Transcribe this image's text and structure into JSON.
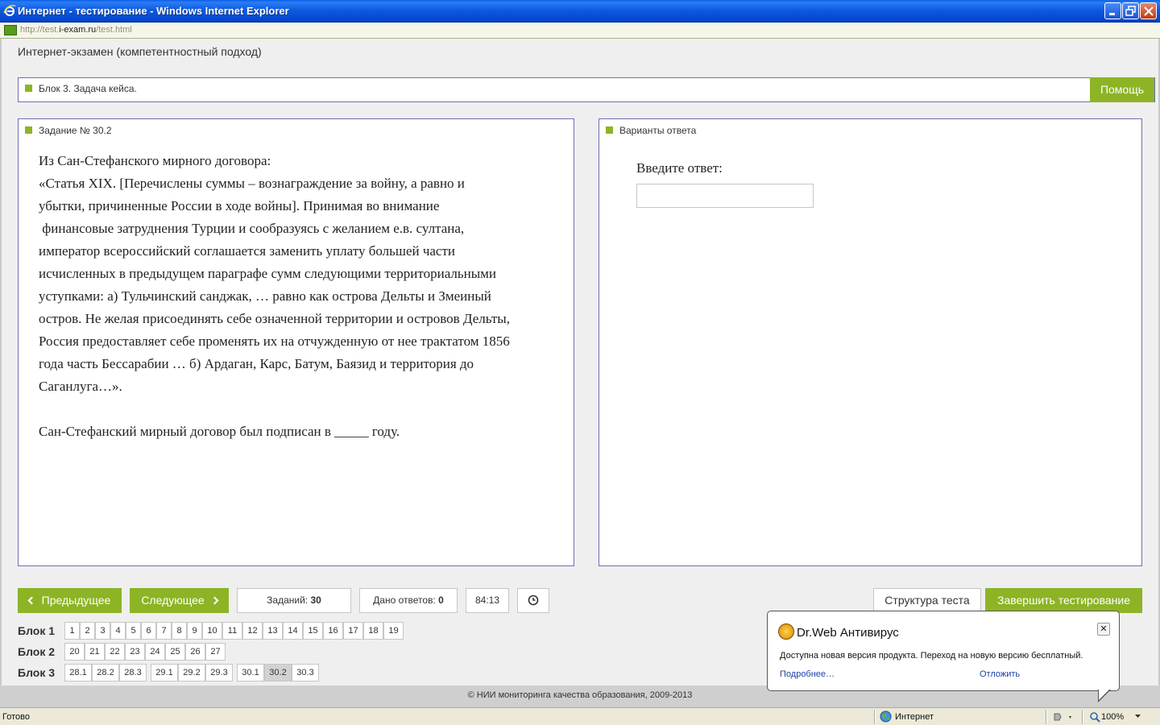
{
  "window": {
    "title": "Интернет - тестирование - Windows Internet Explorer",
    "url_prefix": "http://test.",
    "url_host": "i-exam.ru",
    "url_path": "/test.html"
  },
  "page": {
    "exam_title": "Интернет-экзамен (компетентностный подход)",
    "block_header": "Блок 3. Задача кейса.",
    "help_label": "Помощь"
  },
  "task": {
    "label": "Задание № 30.2",
    "paragraphs": [
      "Из Сан-Стефанского мирного договора:",
      "«Статья XIX. [Перечислены суммы – вознаграждение за войну, а равно и",
      "убытки, причиненные России в ходе войны]. Принимая во внимание",
      " финансовые затруднения Турции и сообразуясь с желанием е.в. султана,",
      "император всероссийский соглашается заменить уплату большей части",
      "исчисленных в предыдущем параграфе сумм следующими территориальными",
      "уступками: а) Тульчинский санджак, … равно как острова Дельты и Змеиный",
      "остров. Не желая присоединять себе означенной территории и островов Дельты,",
      "Россия предоставляет себе променять их на отчужденную от нее трактатом 1856",
      "года часть Бессарабии … б) Ардаган, Карс, Батум, Баязид и территория до",
      "Саганлуга…».",
      "",
      "Сан-Стефанский мирный договор был подписан в _____ году."
    ]
  },
  "answers": {
    "label": "Варианты ответа",
    "prompt": "Введите ответ:",
    "value": ""
  },
  "nav": {
    "prev_label": "Предыдущее",
    "next_label": "Следующее",
    "tasks_label": "Заданий:",
    "tasks_count": "30",
    "answered_label": "Дано ответов:",
    "answered_count": "0",
    "timer": "84:13",
    "structure_label": "Структура теста",
    "finish_label": "Завершить тестирование"
  },
  "blocks": [
    {
      "label": "Блок 1",
      "items": [
        "1",
        "2",
        "3",
        "4",
        "5",
        "6",
        "7",
        "8",
        "9",
        "10",
        "11",
        "12",
        "13",
        "14",
        "15",
        "16",
        "17",
        "18",
        "19"
      ]
    },
    {
      "label": "Блок 2",
      "items": [
        "20",
        "21",
        "22",
        "23",
        "24",
        "25",
        "26",
        "27"
      ]
    },
    {
      "label": "Блок 3",
      "groups": [
        [
          "28.1",
          "28.2",
          "28.3"
        ],
        [
          "29.1",
          "29.2",
          "29.3"
        ],
        [
          "30.1",
          "30.2",
          "30.3"
        ]
      ],
      "active": "30.2"
    }
  ],
  "footer": "© НИИ мониторинга качества образования, 2009-2013",
  "popup": {
    "title": "Dr.Web Антивирус",
    "message": "Доступна новая версия продукта. Переход на новую версию бесплатный.",
    "more_link": "Подробнее…",
    "later_link": "Отложить"
  },
  "status": {
    "text": "Готово",
    "zone": "Интернет",
    "zoom": "100%"
  },
  "colors": {
    "accent_green": "#8db424",
    "panel_border": "#6d6fb4",
    "titlebar_blue": "#0546cf"
  }
}
